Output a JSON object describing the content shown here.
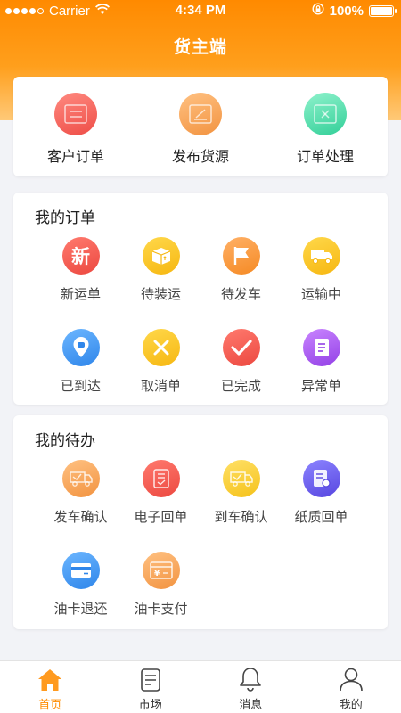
{
  "status_bar": {
    "carrier": "Carrier",
    "time": "4:34 PM",
    "battery": "100%"
  },
  "nav": {
    "title": "货主端"
  },
  "quick_actions": [
    {
      "label": "客户订单",
      "icon": "customer-order-icon",
      "color": "#f0645c"
    },
    {
      "label": "发布货源",
      "icon": "publish-cargo-icon",
      "color": "#f7a24a"
    },
    {
      "label": "订单处理",
      "icon": "order-processing-icon",
      "color": "#3fd8a4"
    }
  ],
  "my_orders": {
    "title": "我的订单",
    "items": [
      {
        "label": "新运单",
        "icon": "new-waybill-icon",
        "glyph": "新"
      },
      {
        "label": "待装运",
        "icon": "pending-loading-icon"
      },
      {
        "label": "待发车",
        "icon": "pending-departure-icon"
      },
      {
        "label": "运输中",
        "icon": "in-transit-icon"
      },
      {
        "label": "已到达",
        "icon": "arrived-icon"
      },
      {
        "label": "取消单",
        "icon": "cancelled-icon"
      },
      {
        "label": "已完成",
        "icon": "completed-icon"
      },
      {
        "label": "异常单",
        "icon": "exception-icon"
      }
    ]
  },
  "my_todos": {
    "title": "我的待办",
    "items": [
      {
        "label": "发车确认",
        "icon": "departure-confirm-icon"
      },
      {
        "label": "电子回单",
        "icon": "e-receipt-icon"
      },
      {
        "label": "到车确认",
        "icon": "arrival-confirm-icon"
      },
      {
        "label": "纸质回单",
        "icon": "paper-receipt-icon"
      },
      {
        "label": "油卡退还",
        "icon": "fuel-card-return-icon"
      },
      {
        "label": "油卡支付",
        "icon": "fuel-card-payment-icon",
        "glyph": "¥"
      }
    ]
  },
  "tabbar": {
    "active_color": "#ff8c00",
    "tabs": [
      {
        "label": "首页",
        "icon": "home-icon",
        "active": true
      },
      {
        "label": "市场",
        "icon": "market-icon",
        "active": false
      },
      {
        "label": "消息",
        "icon": "bell-icon",
        "active": false
      },
      {
        "label": "我的",
        "icon": "profile-icon",
        "active": false
      }
    ]
  }
}
